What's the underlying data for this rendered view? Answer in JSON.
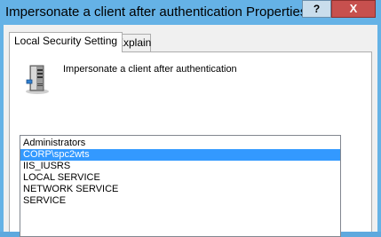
{
  "window": {
    "title": "Impersonate a client after authentication Properties",
    "help_label": "?",
    "close_label": "X"
  },
  "tabs": [
    {
      "label": "Local Security Setting",
      "active": true
    },
    {
      "label": "Explain",
      "active": false
    }
  ],
  "policy": {
    "name": "Impersonate a client after authentication",
    "icon": "server-icon"
  },
  "accounts": {
    "items": [
      {
        "label": "Administrators",
        "selected": false
      },
      {
        "label": "CORP\\spc2wts",
        "selected": true
      },
      {
        "label": "IIS_IUSRS",
        "selected": false
      },
      {
        "label": "LOCAL SERVICE",
        "selected": false
      },
      {
        "label": "NETWORK SERVICE",
        "selected": false
      },
      {
        "label": "SERVICE",
        "selected": false
      }
    ]
  },
  "colors": {
    "title_bar": "#65b2e6",
    "close": "#c7504e",
    "selection": "#3399ff"
  }
}
